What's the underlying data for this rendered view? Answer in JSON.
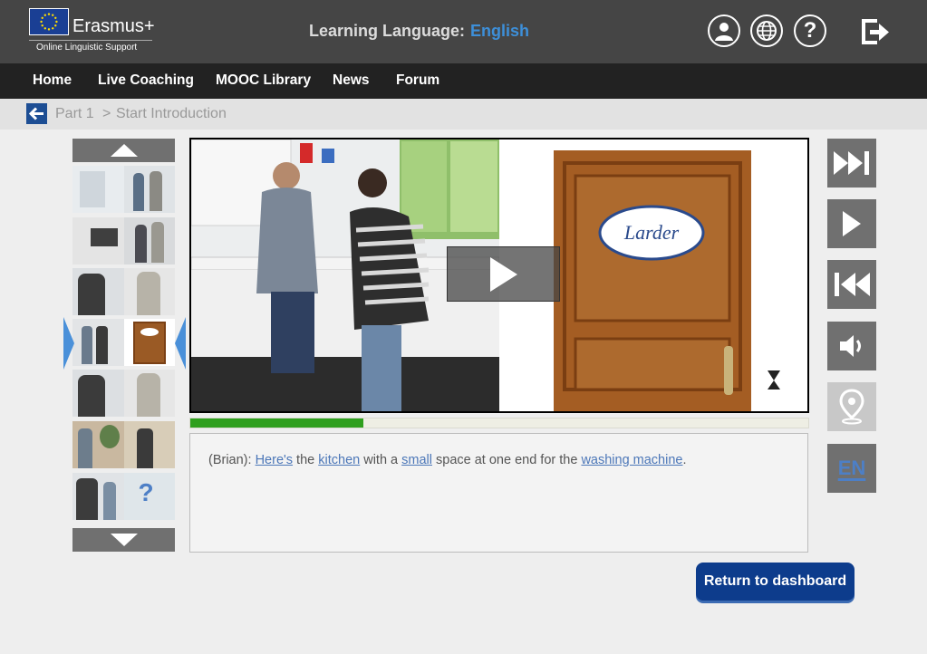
{
  "header": {
    "brand_name": "Erasmus+",
    "brand_subtitle": "Online Linguistic Support",
    "learning_language_label": "Learning Language:",
    "learning_language_value": "English",
    "icons": [
      "user-icon",
      "globe-icon",
      "help-icon",
      "logout-icon"
    ],
    "colors": {
      "header_bg": "#454545",
      "accent": "#3d8fd9"
    }
  },
  "nav": {
    "items": [
      {
        "label": "Home"
      },
      {
        "label": "Live Coaching"
      },
      {
        "label": "MOOC Library"
      },
      {
        "label": "News"
      },
      {
        "label": "Forum"
      }
    ]
  },
  "breadcrumb": {
    "part": "Part 1",
    "separator": ">",
    "current": "Start Introduction"
  },
  "player": {
    "progress_fraction": 0.28,
    "door_sign": "Larder",
    "play_icon": "play-icon",
    "colors": {
      "progress": "#2f9f1e"
    }
  },
  "subtitle": {
    "speaker": "(Brian):",
    "segments": [
      {
        "text": "Here's",
        "link": true
      },
      {
        "text": " the ",
        "link": false
      },
      {
        "text": "kitchen",
        "link": true
      },
      {
        "text": " with a ",
        "link": false
      },
      {
        "text": "small",
        "link": true
      },
      {
        "text": " space at one end for the ",
        "link": false
      },
      {
        "text": "washing machine",
        "link": true
      },
      {
        "text": ".",
        "link": false
      }
    ]
  },
  "controls": {
    "items": [
      "skip-forward-icon",
      "play-icon",
      "rewind-icon",
      "volume-icon",
      "location-pin-icon"
    ],
    "language_code": "EN"
  },
  "footer": {
    "dashboard_button": "Return to dashboard"
  }
}
